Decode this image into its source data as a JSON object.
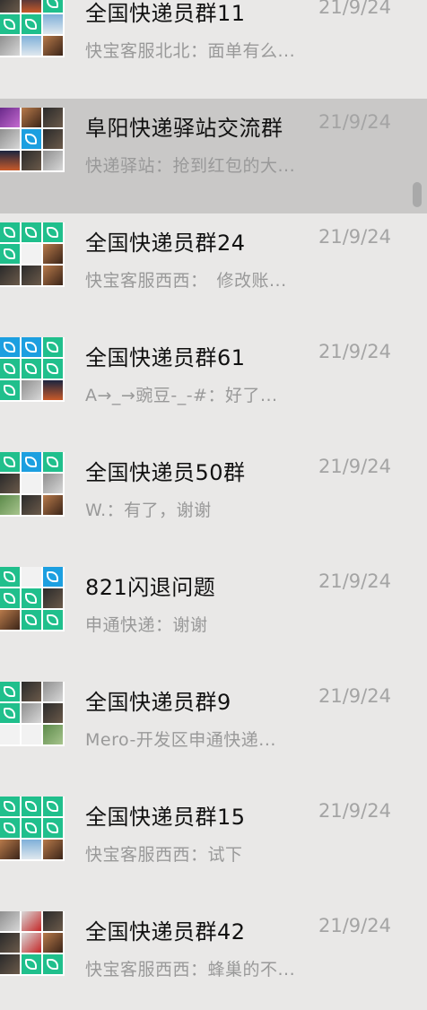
{
  "chats": [
    {
      "title": "全国快递员群11",
      "time": "21/9/24",
      "preview": "快宝客服北北：面单有么...",
      "avatars": [
        "photo-dark",
        "photo-night",
        "logo",
        "logo",
        "logo",
        "photo-sky",
        "photo-gray",
        "photo-sky",
        "photo-warm"
      ]
    },
    {
      "title": "阜阳快递驿站交流群",
      "time": "21/9/24",
      "preview": "快递驿站：抢到红包的大...",
      "avatars": [
        "photo-purple",
        "photo-warm",
        "photo-dark",
        "photo-gray",
        "logo-blue",
        "photo-dark",
        "photo-night",
        "photo-dark",
        "photo-gray"
      ]
    },
    {
      "title": "全国快递员群24",
      "time": "21/9/24",
      "preview": "快宝客服西西：　修改账...",
      "avatars": [
        "logo",
        "logo",
        "logo",
        "logo",
        "photo-light",
        "photo-warm",
        "photo-dark",
        "photo-dark",
        "photo-warm"
      ]
    },
    {
      "title": "全国快递员群61",
      "time": "21/9/24",
      "preview": "A→_→豌豆-_-#：好了...",
      "avatars": [
        "logo-blue",
        "logo-blue",
        "logo",
        "logo",
        "logo",
        "logo",
        "logo",
        "photo-gray",
        "photo-night"
      ]
    },
    {
      "title": "全国快递员50群",
      "time": "21/9/24",
      "preview": "W.：有了，谢谢",
      "avatars": [
        "logo",
        "logo-blue",
        "logo",
        "photo-dark",
        "photo-light",
        "photo-gray",
        "photo-green",
        "photo-dark",
        "photo-warm"
      ]
    },
    {
      "title": "821闪退问题",
      "time": "21/9/24",
      "preview": "申通快递：谢谢",
      "avatars": [
        "logo",
        "photo-light",
        "logo-blue",
        "logo",
        "logo",
        "photo-dark",
        "photo-warm",
        "logo",
        "logo"
      ]
    },
    {
      "title": "全国快递员群9",
      "time": "21/9/24",
      "preview": "Mero-开发区申通快递...",
      "avatars": [
        "logo",
        "photo-dark",
        "photo-gray",
        "logo",
        "photo-gray",
        "photo-dark",
        "photo-light",
        "photo-light",
        "photo-green"
      ]
    },
    {
      "title": "全国快递员群15",
      "time": "21/9/24",
      "preview": "快宝客服西西：试下",
      "avatars": [
        "logo",
        "logo",
        "logo",
        "logo",
        "logo",
        "logo",
        "photo-warm",
        "photo-sky",
        "photo-warm"
      ]
    },
    {
      "title": "全国快递员群42",
      "time": "21/9/24",
      "preview": "快宝客服西西：蜂巢的不...",
      "avatars": [
        "photo-gray",
        "photo-red",
        "photo-dark",
        "photo-dark",
        "photo-red",
        "photo-warm",
        "photo-dark",
        "logo",
        "logo"
      ]
    }
  ],
  "selected_index": 1,
  "colors": {
    "background": "#e9e8e7",
    "selected_background": "#c9c8c7",
    "title": "#111111",
    "time": "#a4a4a4",
    "preview": "#999999",
    "logo_green": "#20bf8c",
    "logo_blue": "#1c9fe0"
  }
}
